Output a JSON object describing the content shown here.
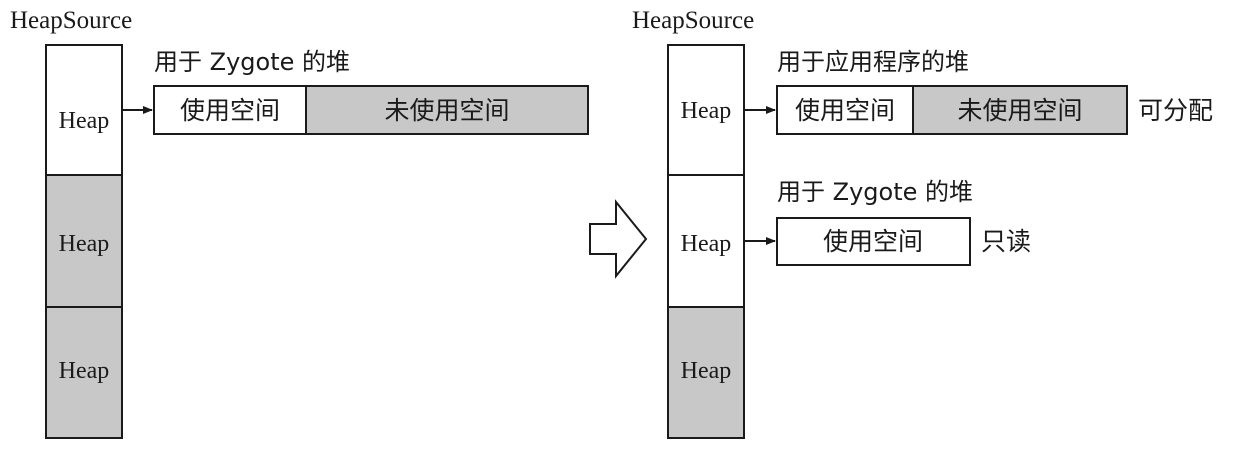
{
  "colors": {
    "stroke": "#1a1a1a",
    "used_fill": "#ffffff",
    "unused_fill": "#c8c8c8",
    "heap_gray": "#c8c8c8"
  },
  "left": {
    "title": "HeapSource",
    "heaps": [
      {
        "label": "Heap",
        "active": true
      },
      {
        "label": "Heap",
        "active": false
      },
      {
        "label": "Heap",
        "active": false
      }
    ],
    "zygote_caption": "用于 Zygote 的堆",
    "used_label": "使用空间",
    "unused_label": "未使用空间"
  },
  "arrow": {
    "icon": "hollow-right-arrow-icon"
  },
  "right": {
    "title": "HeapSource",
    "heaps": [
      {
        "label": "Heap",
        "active": true
      },
      {
        "label": "Heap",
        "active": true
      },
      {
        "label": "Heap",
        "active": false
      }
    ],
    "app_caption": "用于应用程序的堆",
    "app_used_label": "使用空间",
    "app_unused_label": "未使用空间",
    "app_note": "可分配",
    "zygote_caption": "用于 Zygote 的堆",
    "zygote_used_label": "使用空间",
    "zygote_note": "只读"
  }
}
